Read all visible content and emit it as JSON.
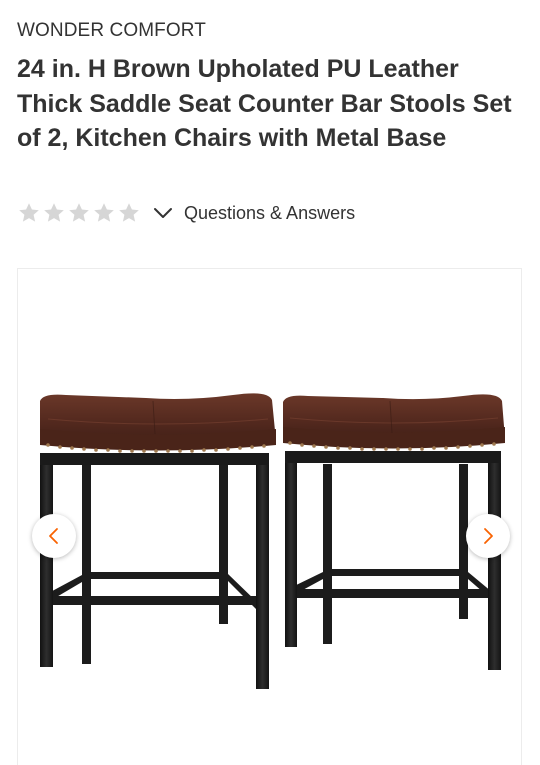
{
  "product": {
    "brand": "WONDER COMFORT",
    "title": "24 in. H Brown Upholated PU Leather Thick Saddle Seat Counter Bar Stools Set of 2, Kitchen Chairs with Metal Base"
  },
  "reviews": {
    "rating": 0,
    "max_rating": 5,
    "qa_label": "Questions & Answers"
  },
  "gallery": {
    "image_subject": "two-brown-leather-saddle-bar-stools",
    "prev_icon": "chevron-left-icon",
    "next_icon": "chevron-right-icon"
  },
  "colors": {
    "text": "#333333",
    "star_empty": "#d6d6d6",
    "accent": "#f96302",
    "seat_leather": "#5a2e22",
    "metal_frame": "#1c1c1c"
  }
}
